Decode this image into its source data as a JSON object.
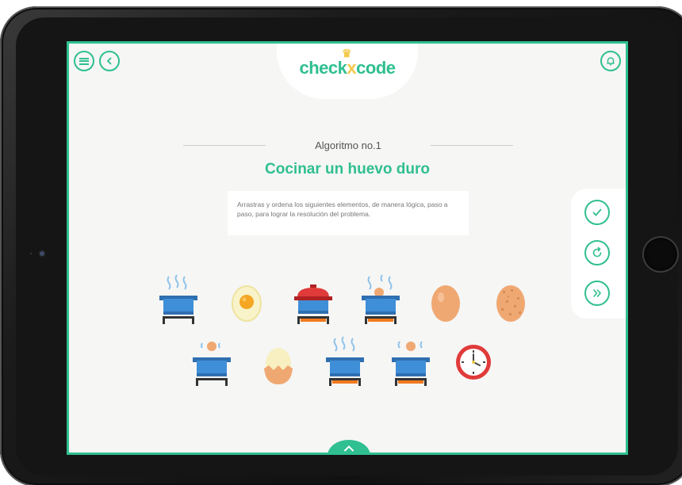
{
  "header": {
    "logo_text": "check",
    "logo_x": "x",
    "logo_text_end": "code"
  },
  "icons": {
    "menu": "menu-icon",
    "back": "chevron-left-icon",
    "bell": "bell-icon",
    "check": "check-icon",
    "refresh": "refresh-icon",
    "forward": "double-chevron-right-icon",
    "up": "chevron-up-icon"
  },
  "main": {
    "subtitle": "Algoritmo no.1",
    "title": "Cocinar un huevo duro",
    "instruction": "Arrastras y ordena los siguientes elementos, de manera lógica, paso a paso, para lograr la resolución del problema."
  },
  "items": [
    "pot-steaming-unlit-stove",
    "egg-cracked-yolk",
    "pot-lid-lit-stove",
    "pot-egg-steaming-lit-stove",
    "whole-egg",
    "speckled-egg",
    "pot-egg-unlit-stove",
    "peeled-egg",
    "pot-steaming-lit-stove",
    "pot-egg-steaming-lit-stove-2",
    "clock"
  ],
  "colors": {
    "accent": "#2fbf90",
    "gold": "#f2c94c",
    "pot": "#3f8fd8",
    "egg": "#f0a872",
    "flame": "#f07a1f",
    "clock": "#e03a3a"
  }
}
